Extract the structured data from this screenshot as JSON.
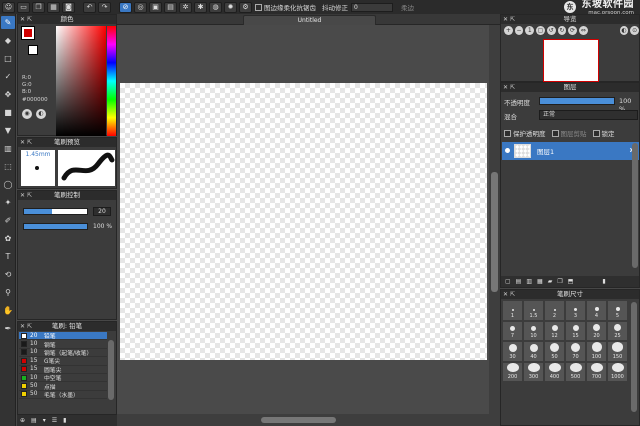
{
  "document_tab": "Untitled",
  "brand": {
    "name": "东坡软件园",
    "url": "mac.orsoon.com"
  },
  "toolbar": {
    "buttons": [
      "user-icon",
      "chat-icon",
      "window-icon",
      "grid-icon",
      "camera-icon",
      "undo-icon",
      "redo-icon"
    ],
    "antialias_label": "图边缘柔化抗锯齿",
    "stabilizer_label": "抖动修正",
    "stabilizer_value": "0",
    "soft_label": "柔边"
  },
  "color_panel": {
    "title": "颜色",
    "rgb": {
      "r": "R:0",
      "g": "G:0",
      "b": "B:0"
    },
    "hex": "#000000",
    "foreground": "#d00000",
    "background": "#ffffff"
  },
  "brush_preview": {
    "title": "笔刷预览",
    "size": "1.45mm"
  },
  "brush_control": {
    "title": "笔刷控制",
    "size_value": "20",
    "size_fraction": 0.45,
    "opacity_label": "100 %",
    "opacity_fraction": 1.0
  },
  "brush_list": {
    "title": "笔刷: 铅笔",
    "items": [
      {
        "size": "20",
        "name": "铅笔",
        "color": "#ffffff",
        "selected": true
      },
      {
        "size": "10",
        "name": "钢笔",
        "color": "#1a1a1a",
        "selected": false
      },
      {
        "size": "10",
        "name": "钢笔（起笔/收笔）",
        "color": "#1a1a1a",
        "selected": false
      },
      {
        "size": "15",
        "name": "G笔尖",
        "color": "#d00000",
        "selected": false
      },
      {
        "size": "15",
        "name": "圆笔尖",
        "color": "#d00000",
        "selected": false
      },
      {
        "size": "10",
        "name": "中空笔",
        "color": "#18b020",
        "selected": false
      },
      {
        "size": "50",
        "name": "点描",
        "color": "#f0d000",
        "selected": false
      },
      {
        "size": "50",
        "name": "毛笔（水墨）",
        "color": "#f0d000",
        "selected": false
      }
    ]
  },
  "navigator": {
    "title": "导览"
  },
  "layer_panel": {
    "title": "图层",
    "opacity_label": "不透明度",
    "opacity_value": "100 %",
    "blend_label": "混合",
    "blend_value": "正常",
    "protect_alpha": "保护透明度",
    "clip": "图层剪贴",
    "lock": "锁定",
    "layer_name": "图层1"
  },
  "brush_size_panel": {
    "title": "笔刷尺寸",
    "sizes": [
      "1",
      "1.5",
      "2",
      "3",
      "4",
      "5",
      "7",
      "10",
      "12",
      "15",
      "20",
      "25",
      "30",
      "40",
      "50",
      "70",
      "100",
      "150",
      "200",
      "300",
      "400",
      "500",
      "700",
      "1000"
    ]
  }
}
